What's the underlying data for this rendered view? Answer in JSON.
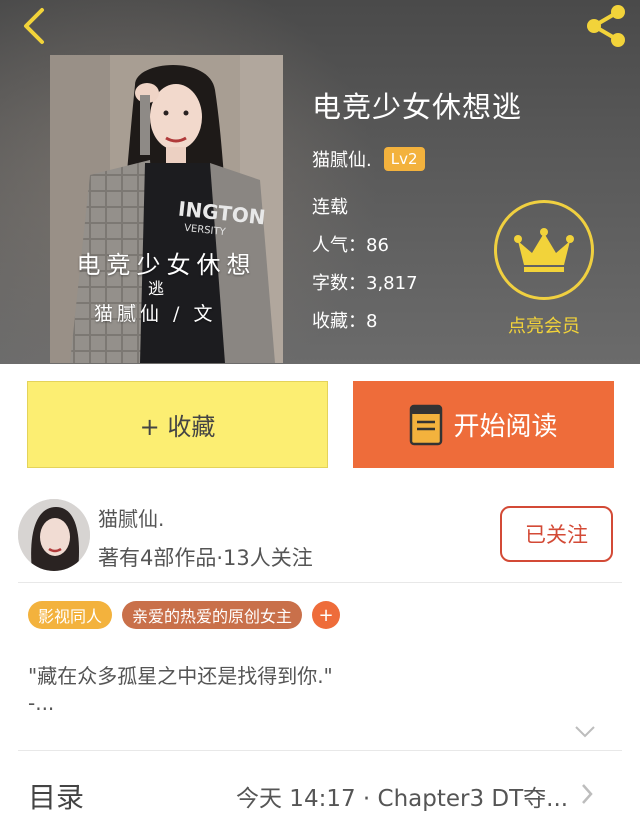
{
  "book": {
    "title": "电竞少女休想逃",
    "author": "猫腻仙.",
    "level": "Lv2",
    "status": "连载",
    "popularity": "人气：86",
    "word_count": "字数：3,817",
    "favorites": "收藏：8"
  },
  "cover": {
    "title_text": "电竞少女休想",
    "title_extra": "逃",
    "author_text": "猫腻仙 / 文",
    "shirt_text": "INGTON",
    "shirt_subtext": "VERSITY"
  },
  "vip": {
    "label": "点亮会员",
    "icon": "crown-icon"
  },
  "actions": {
    "favorite_label": "+ 收藏",
    "read_label": "开始阅读"
  },
  "author_card": {
    "name": "猫腻仙.",
    "info": "著有4部作品·13人关注",
    "follow_label": "已关注"
  },
  "tags": [
    "影视同人",
    "亲爱的热爱的原创女主"
  ],
  "tag_add": "+",
  "synopsis": {
    "line1": "\"藏在众多孤星之中还是找得到你.\"",
    "line2": "-..."
  },
  "toc": {
    "label": "目录",
    "latest": "今天 14:17 · Chapter3 DT夺..."
  },
  "colors": {
    "orange": "#ee6c3a",
    "yellow": "#fcee72",
    "gold": "#f2d33a",
    "follow_red": "#d34a36",
    "tag_gold": "#f3b23d",
    "tag_brown": "#c9704a"
  }
}
